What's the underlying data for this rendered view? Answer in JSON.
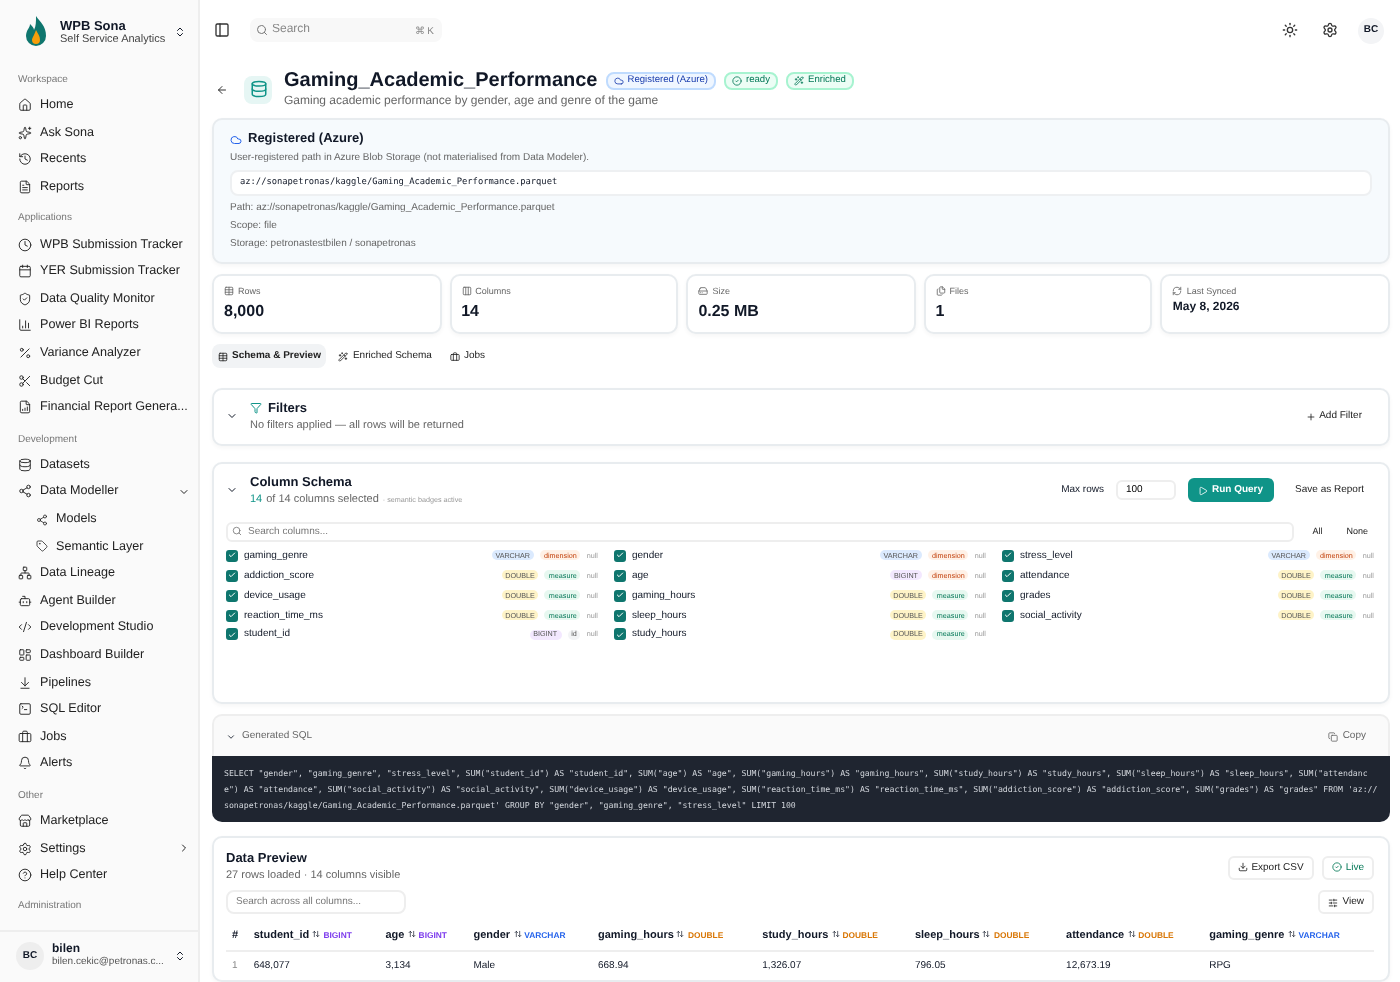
{
  "brand": {
    "name": "WPB Sona",
    "subtitle": "Self Service Analytics"
  },
  "sidebar": {
    "sections": [
      {
        "label": "Workspace",
        "items": [
          {
            "label": "Home"
          },
          {
            "label": "Ask Sona"
          },
          {
            "label": "Recents"
          },
          {
            "label": "Reports"
          }
        ]
      },
      {
        "label": "Applications",
        "items": [
          {
            "label": "WPB Submission Tracker"
          },
          {
            "label": "YER Submission Tracker"
          },
          {
            "label": "Data Quality Monitor"
          },
          {
            "label": "Power BI Reports"
          },
          {
            "label": "Variance Analyzer"
          },
          {
            "label": "Budget Cut"
          },
          {
            "label": "Financial Report Genera..."
          }
        ]
      },
      {
        "label": "Development",
        "items": [
          {
            "label": "Datasets"
          },
          {
            "label": "Data Modeller",
            "expanded": true,
            "children": [
              {
                "label": "Models"
              },
              {
                "label": "Semantic Layer"
              }
            ]
          },
          {
            "label": "Data Lineage"
          },
          {
            "label": "Agent Builder"
          },
          {
            "label": "Development Studio"
          },
          {
            "label": "Dashboard Builder"
          },
          {
            "label": "Pipelines"
          },
          {
            "label": "SQL Editor"
          },
          {
            "label": "Jobs"
          },
          {
            "label": "Alerts"
          }
        ]
      },
      {
        "label": "Other",
        "items": [
          {
            "label": "Marketplace"
          },
          {
            "label": "Settings",
            "has_submenu": true
          },
          {
            "label": "Help Center"
          }
        ]
      },
      {
        "label": "Administration"
      }
    ]
  },
  "user": {
    "initials": "BC",
    "name": "bilen",
    "email": "bilen.cekic@petronas.c..."
  },
  "topbar": {
    "search_placeholder": "Search",
    "shortcut": "⌘ K",
    "avatar": "BC"
  },
  "dataset": {
    "title": "Gaming_Academic_Performance",
    "badges": [
      {
        "label": "Registered (Azure)",
        "kind": "registered"
      },
      {
        "label": "ready",
        "kind": "ready"
      },
      {
        "label": "Enriched",
        "kind": "enriched"
      }
    ],
    "description": "Gaming academic performance by gender, age and genre of the game"
  },
  "registered": {
    "title": "Registered (Azure)",
    "note": "User-registered path in Azure Blob Storage (not materialised from Data Modeler).",
    "uri": "az://sonapetronas/kaggle/Gaming_Academic_Performance.parquet",
    "details": [
      "Path: az://sonapetronas/kaggle/Gaming_Academic_Performance.parquet",
      "Scope: file",
      "Storage: petronastestbilen / sonapetronas"
    ]
  },
  "stats": [
    {
      "label": "Rows",
      "value": "8,000"
    },
    {
      "label": "Columns",
      "value": "14"
    },
    {
      "label": "Size",
      "value": "0.25 MB"
    },
    {
      "label": "Files",
      "value": "1"
    },
    {
      "label": "Last Synced",
      "value": "May 8, 2026"
    }
  ],
  "tabs": [
    {
      "label": "Schema & Preview",
      "selected": true
    },
    {
      "label": "Enriched Schema",
      "selected": false
    },
    {
      "label": "Jobs",
      "selected": false
    }
  ],
  "filters": {
    "title": "Filters",
    "note": "No filters applied — all rows will be returned",
    "add_button": "Add Filter"
  },
  "schema": {
    "title": "Column Schema",
    "selected_count": "14",
    "count_rest": "of 14 columns selected",
    "hint": "· semantic badges active",
    "max_rows_label": "Max rows",
    "max_rows": "100",
    "run_button": "Run Query",
    "save_button": "Save as Report",
    "search_placeholder": "Search columns...",
    "all_button": "All",
    "none_button": "None",
    "columns": [
      {
        "name": "gaming_genre",
        "type": "VARCHAR",
        "color": "#dbeafe",
        "role": "dimension",
        "kind": "dimension",
        "nullable": "null",
        "checked": true
      },
      {
        "name": "gender",
        "type": "VARCHAR",
        "color": "#dbeafe",
        "role": "dimension",
        "kind": "dimension",
        "nullable": "null",
        "checked": true
      },
      {
        "name": "stress_level",
        "type": "VARCHAR",
        "color": "#dbeafe",
        "role": "dimension",
        "kind": "dimension",
        "nullable": "null",
        "checked": true
      },
      {
        "name": "addiction_score",
        "type": "DOUBLE",
        "color": "#fef3c7",
        "role": "measure",
        "kind": "measure",
        "nullable": "null",
        "checked": true
      },
      {
        "name": "age",
        "type": "BIGINT",
        "color": "#f3e8ff",
        "role": "dimension",
        "kind": "dimension",
        "nullable": "null",
        "checked": true
      },
      {
        "name": "attendance",
        "type": "DOUBLE",
        "color": "#fef3c7",
        "role": "measure",
        "kind": "measure",
        "nullable": "null",
        "checked": true
      },
      {
        "name": "device_usage",
        "type": "DOUBLE",
        "color": "#fef3c7",
        "role": "measure",
        "kind": "measure",
        "nullable": "null",
        "checked": true
      },
      {
        "name": "gaming_hours",
        "type": "DOUBLE",
        "color": "#fef3c7",
        "role": "measure",
        "kind": "measure",
        "nullable": "null",
        "checked": true
      },
      {
        "name": "grades",
        "type": "DOUBLE",
        "color": "#fef3c7",
        "role": "measure",
        "kind": "measure",
        "nullable": "null",
        "checked": true
      },
      {
        "name": "reaction_time_ms",
        "type": "DOUBLE",
        "color": "#fef3c7",
        "role": "measure",
        "kind": "measure",
        "nullable": "null",
        "checked": true
      },
      {
        "name": "sleep_hours",
        "type": "DOUBLE",
        "color": "#fef3c7",
        "role": "measure",
        "kind": "measure",
        "nullable": "null",
        "checked": true
      },
      {
        "name": "social_activity",
        "type": "DOUBLE",
        "color": "#fef3c7",
        "role": "measure",
        "kind": "measure",
        "nullable": "null",
        "checked": true
      },
      {
        "name": "student_id",
        "type": "BIGINT",
        "color": "#f3e8ff",
        "role": "id",
        "kind": "id",
        "nullable": "null",
        "checked": true
      },
      {
        "name": "study_hours",
        "type": "DOUBLE",
        "color": "#fef3c7",
        "role": "measure",
        "kind": "measure",
        "nullable": "null",
        "checked": true
      }
    ]
  },
  "sql": {
    "title": "Generated SQL",
    "copy_button": "Copy",
    "code": "SELECT \"gender\", \"gaming_genre\", \"stress_level\", SUM(\"student_id\") AS \"student_id\", SUM(\"age\") AS \"age\", SUM(\"gaming_hours\") AS \"gaming_hours\", SUM(\"study_hours\") AS \"study_hours\", SUM(\"sleep_hours\") AS \"sleep_hours\", SUM(\"attendance\") AS \"attendance\", SUM(\"social_activity\") AS \"social_activity\", SUM(\"device_usage\") AS \"device_usage\", SUM(\"reaction_time_ms\") AS \"reaction_time_ms\", SUM(\"addiction_score\") AS \"addiction_score\", SUM(\"grades\") AS \"grades\" FROM 'az://sonapetronas/kaggle/Gaming_Academic_Performance.parquet' GROUP BY \"gender\", \"gaming_genre\", \"stress_level\" LIMIT 100"
  },
  "preview": {
    "title": "Data Preview",
    "subtitle": "27 rows loaded · 14 columns visible",
    "export_button": "Export CSV",
    "live_button": "Live",
    "search_placeholder": "Search across all columns...",
    "view_button": "View",
    "columns": [
      {
        "label": "student_id",
        "type": "BIGINT",
        "color": "#7c3aed"
      },
      {
        "label": "age",
        "type": "BIGINT",
        "color": "#7c3aed"
      },
      {
        "label": "gender",
        "type": "VARCHAR",
        "color": "#2563eb"
      },
      {
        "label": "gaming_hours",
        "type": "DOUBLE",
        "color": "#d97706"
      },
      {
        "label": "study_hours",
        "type": "DOUBLE",
        "color": "#d97706"
      },
      {
        "label": "sleep_hours",
        "type": "DOUBLE",
        "color": "#d97706"
      },
      {
        "label": "attendance",
        "type": "DOUBLE",
        "color": "#d97706"
      },
      {
        "label": "gaming_genre",
        "type": "VARCHAR",
        "color": "#2563eb"
      }
    ],
    "index_header": "#",
    "rows": [
      {
        "index": "1",
        "cells": [
          "648,077",
          "3,134",
          "Male",
          "668.94",
          "1,326.07",
          "796.05",
          "12,673.19",
          "RPG"
        ]
      }
    ]
  }
}
